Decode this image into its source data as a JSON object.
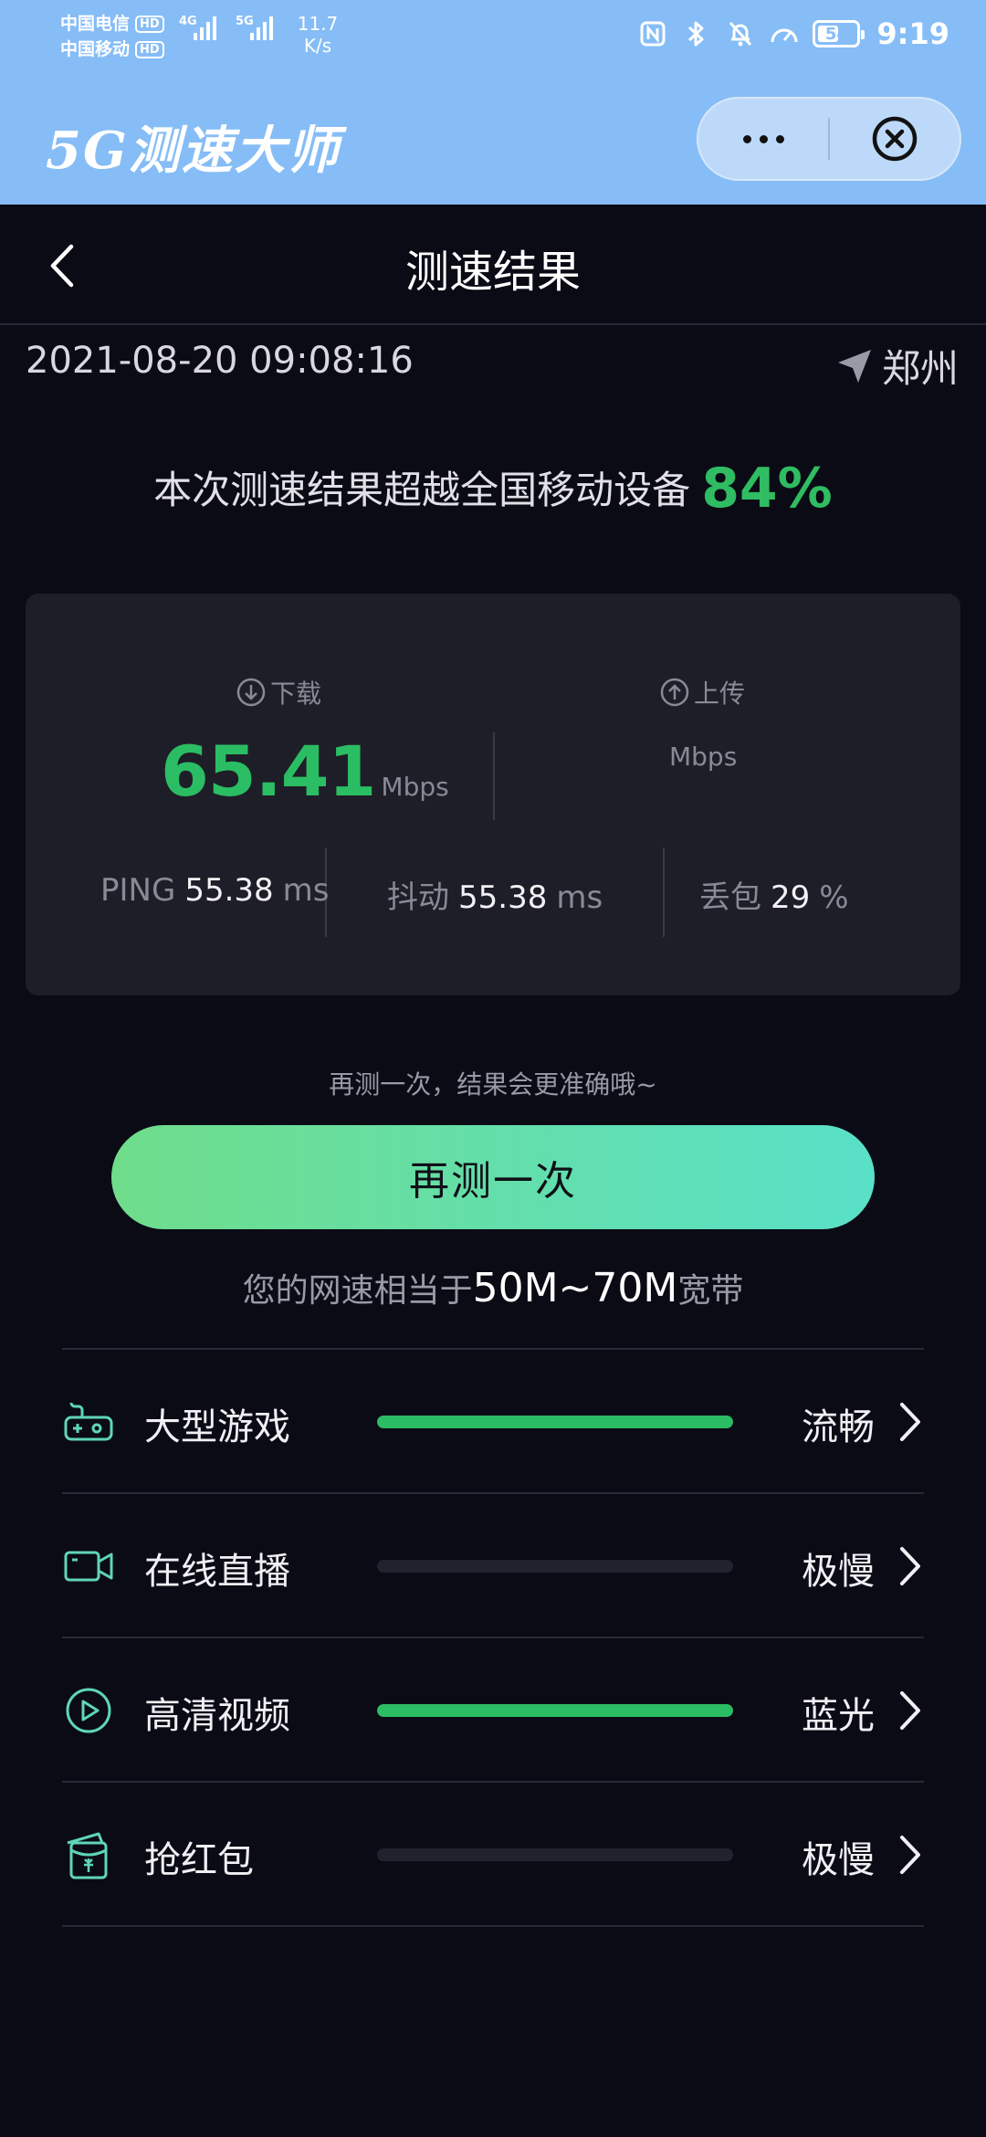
{
  "status_bar": {
    "carrier1": "中国电信",
    "carrier2": "中国移动",
    "hd_badge": "HD",
    "sig1_label": "4G",
    "sig2_label": "5G",
    "net_speed_value": "11.7",
    "net_speed_unit": "K/s",
    "battery": "54",
    "battery_level": 0.54,
    "time": "9:19",
    "icons": [
      "nfc-icon",
      "bluetooth-icon",
      "mute-bell-icon",
      "speedometer-icon"
    ]
  },
  "app": {
    "name": "5G测速大师",
    "capsule_icons": [
      "more-icon",
      "close-circle-icon"
    ]
  },
  "nav": {
    "title": "测速结果"
  },
  "test": {
    "datetime": "2021-08-20 09:08:16",
    "location": "郑州",
    "beat_text": "本次测速结果超越全国移动设备",
    "beat_percent": "84%"
  },
  "result": {
    "download_label": "下载",
    "download_value": "65.41",
    "download_unit": "Mbps",
    "upload_label": "上传",
    "upload_value": "",
    "upload_unit": "Mbps",
    "ping_label": "PING",
    "ping_value": "55.38",
    "ping_unit": "ms",
    "jitter_label": "抖动",
    "jitter_value": "55.38",
    "jitter_unit": "ms",
    "loss_label": "丢包",
    "loss_value": "29",
    "loss_unit": "%"
  },
  "retest": {
    "hint": "再测一次，结果会更准确哦~",
    "button": "再测一次"
  },
  "equivalent": {
    "prefix": "您的网速相当于",
    "range": "50M~70M",
    "suffix": "宽带"
  },
  "scenarios": [
    {
      "name": "大型游戏",
      "level": "流畅",
      "icon": "gamepad-icon",
      "fill": 1.0
    },
    {
      "name": "在线直播",
      "level": "极慢",
      "icon": "video-camera-icon",
      "fill": 0.0
    },
    {
      "name": "高清视频",
      "level": "蓝光",
      "icon": "play-circle-icon",
      "fill": 1.0
    },
    {
      "name": "抢红包",
      "level": "极慢",
      "icon": "red-packet-icon",
      "fill": 0.0
    }
  ],
  "colors": {
    "header_bg": "#86bdf6",
    "page_bg": "#0b0b16",
    "accent_green": "#2bbd63",
    "button_gradient_start": "#6fdd8b",
    "button_gradient_end": "#59e0c8"
  }
}
